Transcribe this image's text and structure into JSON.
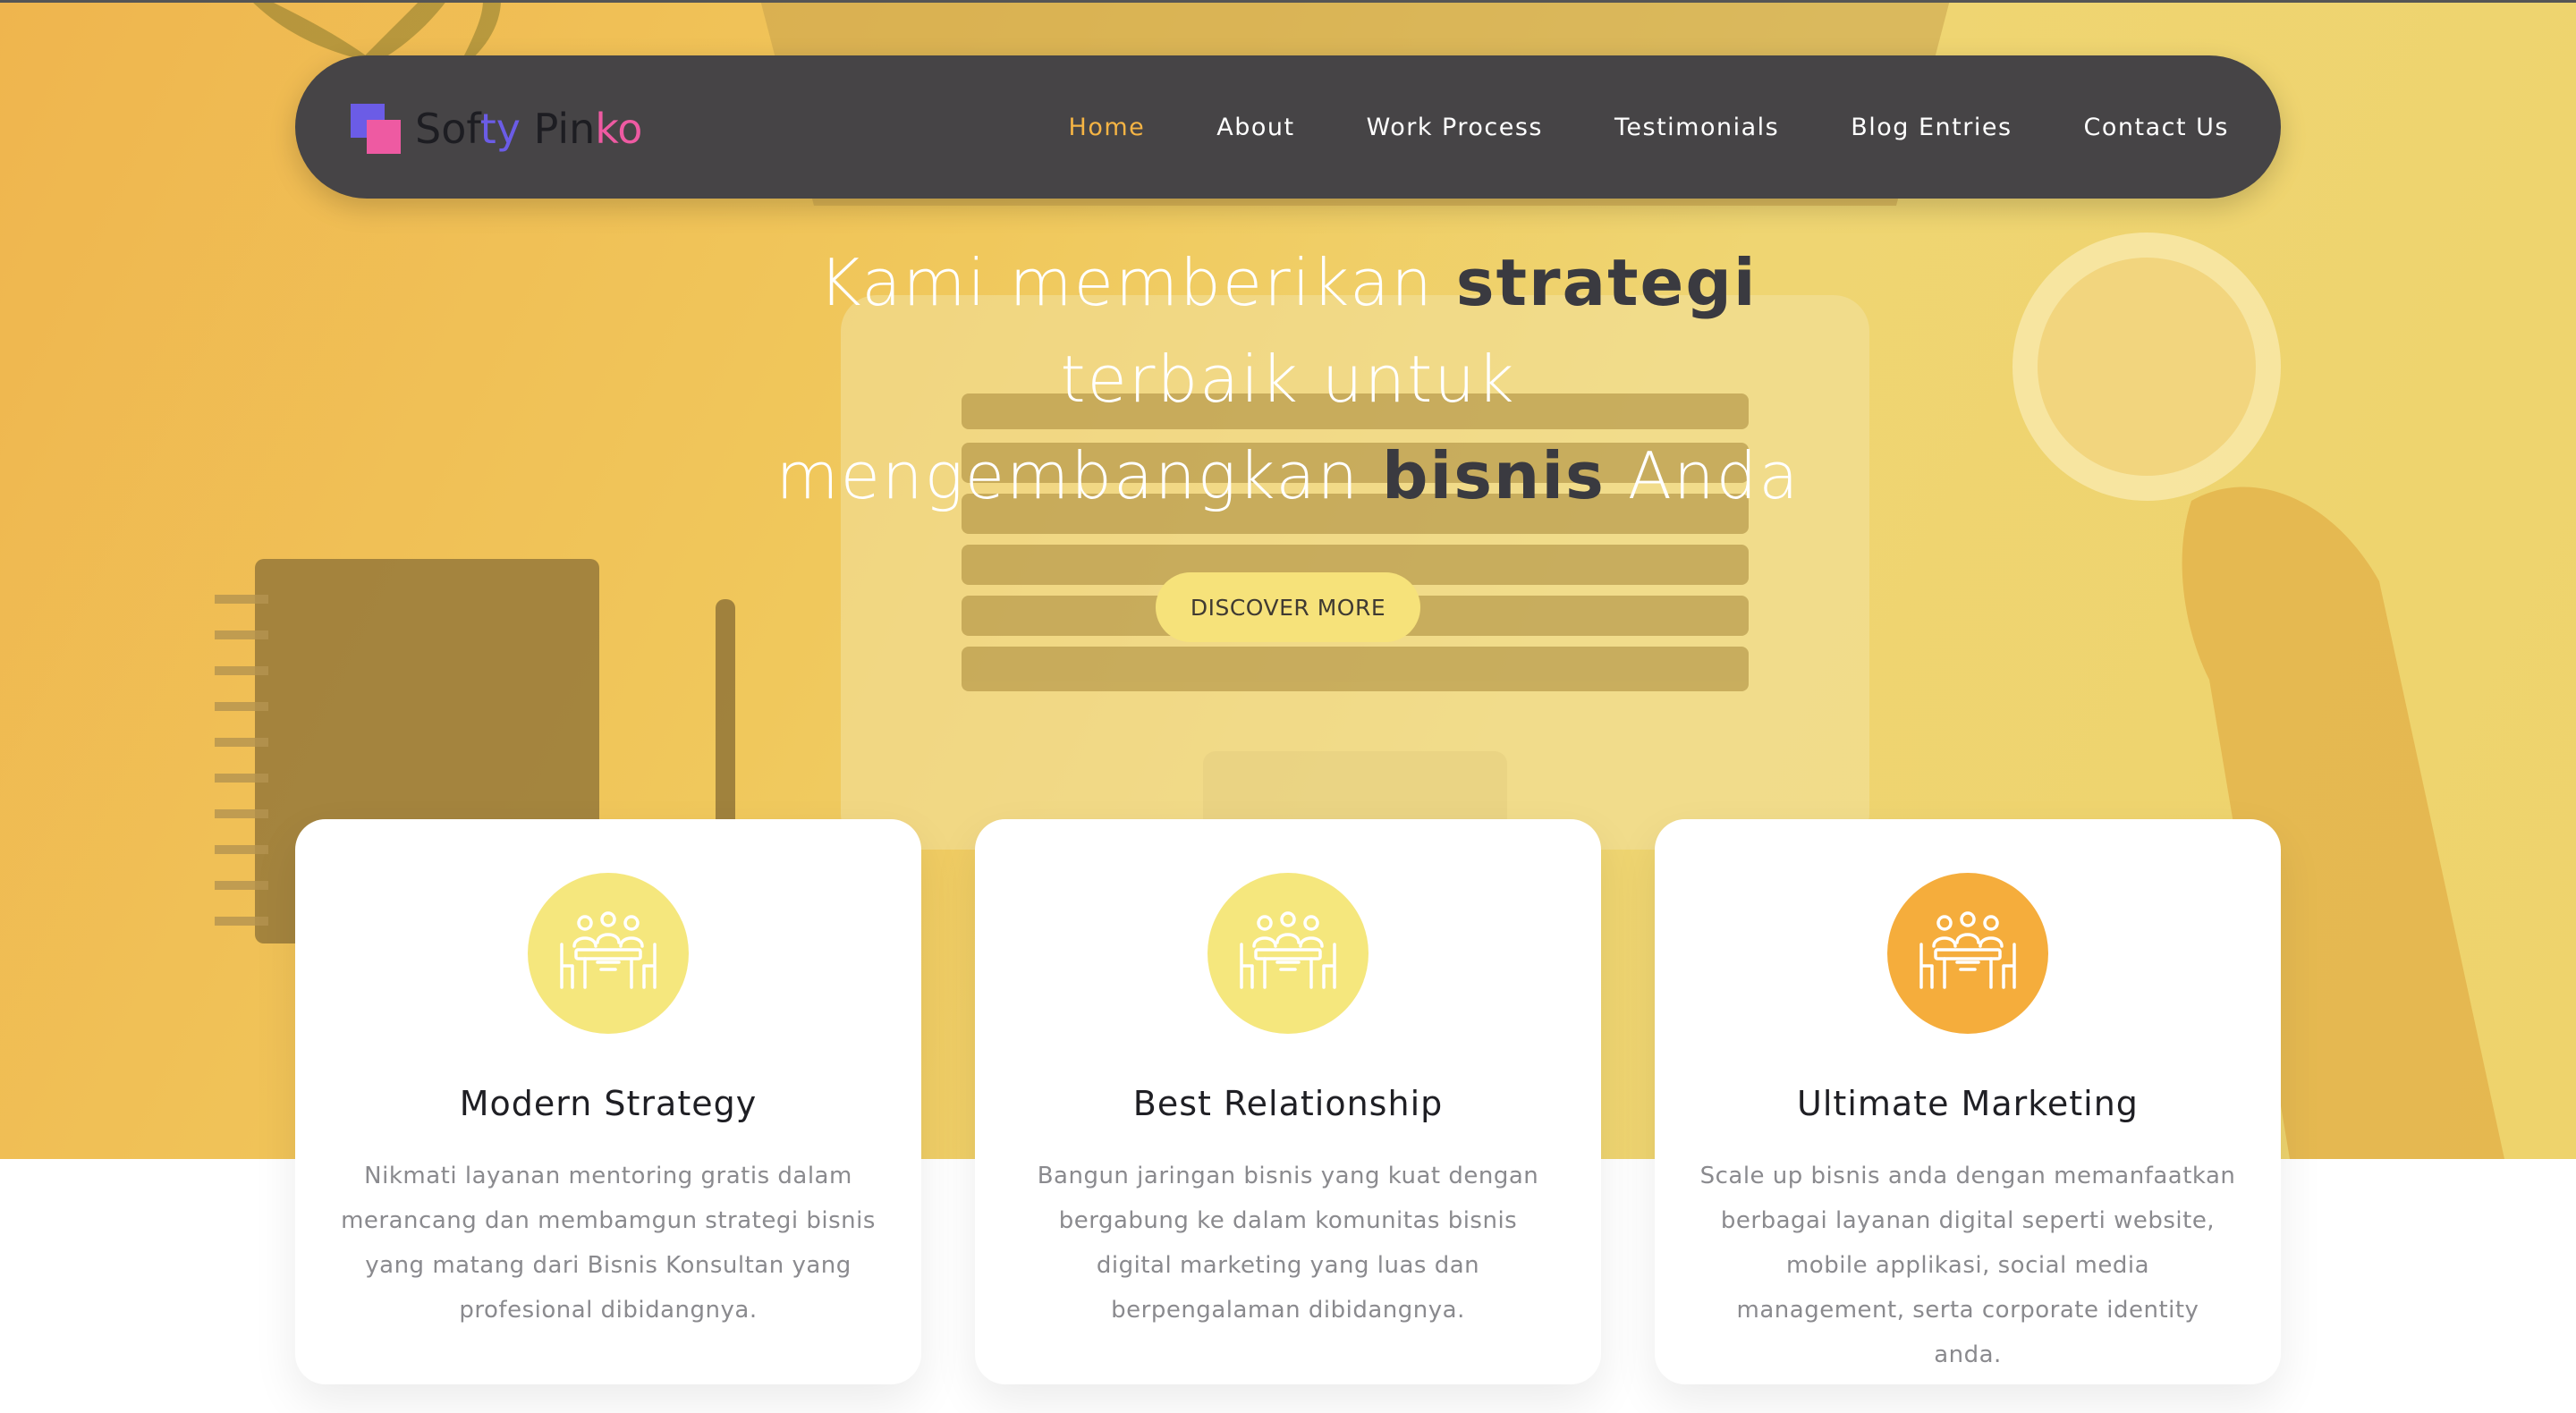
{
  "brand": {
    "parts": [
      "Sof",
      "ty",
      " Pin",
      "ko"
    ],
    "colors": {
      "purple": "#6b5ce6",
      "pink": "#ee5aa2",
      "dark": "#1d1d22"
    }
  },
  "nav": {
    "items": [
      {
        "label": "Home",
        "active": true
      },
      {
        "label": "About",
        "active": false
      },
      {
        "label": "Work Process",
        "active": false
      },
      {
        "label": "Testimonials",
        "active": false
      },
      {
        "label": "Blog Entries",
        "active": false
      },
      {
        "label": "Contact Us",
        "active": false
      }
    ],
    "active_color": "#f5b444"
  },
  "hero": {
    "headline": {
      "line1_pre": "Kami memberikan ",
      "line1_strong": "strategi",
      "line2": "terbaik untuk",
      "line3_pre": "mengembangkan ",
      "line3_strong": "bisnis",
      "line3_post": " Anda"
    },
    "cta_label": "DISCOVER MORE",
    "cta_color": "#f6e27a"
  },
  "features": [
    {
      "title": "Modern Strategy",
      "description": "Nikmati layanan mentoring gratis dalam merancang dan membamgun strategi bisnis yang matang dari Bisnis Konsultan yang profesional dibidangnya.",
      "icon": "meeting-icon",
      "icon_bg": "#f5e77d"
    },
    {
      "title": "Best Relationship",
      "description": "Bangun jaringan bisnis yang kuat dengan bergabung ke dalam komunitas bisnis digital marketing yang luas dan berpengalaman dibidangnya.",
      "icon": "meeting-icon",
      "icon_bg": "#f5e77d"
    },
    {
      "title": "Ultimate Marketing",
      "description": "Scale up bisnis anda dengan memanfaatkan berbagai layanan digital seperti website, mobile applikasi, social media management, serta corporate identity anda.",
      "icon": "meeting-icon",
      "icon_bg": "#f5ad3c"
    }
  ]
}
